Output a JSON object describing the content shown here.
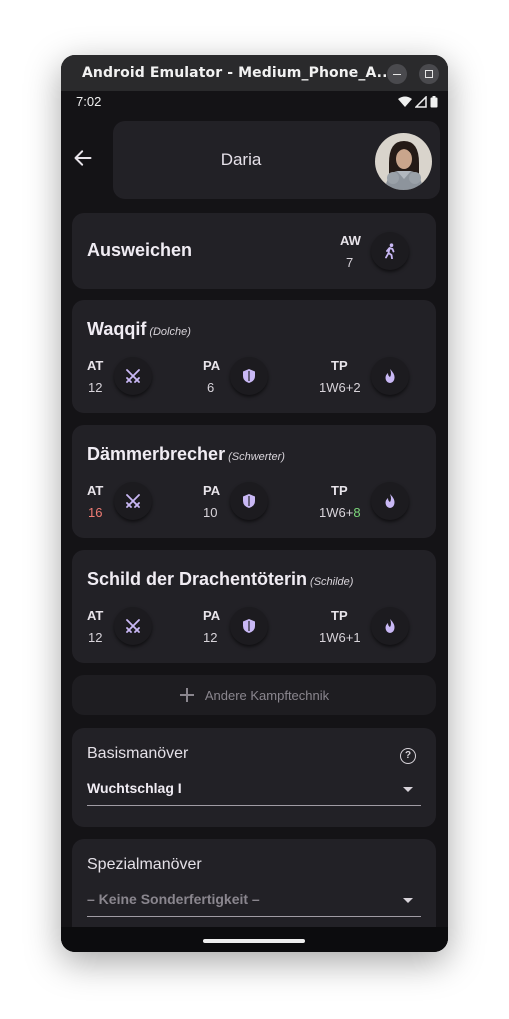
{
  "window": {
    "title": "Android Emulator - Medium_Phone_A..."
  },
  "status": {
    "time": "7:02"
  },
  "header": {
    "character_name": "Daria"
  },
  "dodge": {
    "title": "Ausweichen",
    "stat_label": "AW",
    "stat_value": "7"
  },
  "weapons": [
    {
      "name": "Waqqif",
      "type": "(Dolche)",
      "at_label": "AT",
      "at": "12",
      "pa_label": "PA",
      "pa": "6",
      "tp_label": "TP",
      "tp_base": "1W6+",
      "tp_bonus": "2"
    },
    {
      "name": "Dämmerbrecher",
      "type": "(Schwerter)",
      "at_label": "AT",
      "at": "16",
      "pa_label": "PA",
      "pa": "10",
      "tp_label": "TP",
      "tp_base": "1W6+",
      "tp_bonus": "8"
    },
    {
      "name": "Schild der Drachentöterin",
      "type": "(Schilde)",
      "at_label": "AT",
      "at": "12",
      "pa_label": "PA",
      "pa": "12",
      "tp_label": "TP",
      "tp_base": "1W6+",
      "tp_bonus": "1"
    }
  ],
  "add_technique": {
    "label": "Andere Kampftechnik"
  },
  "basic_maneuver": {
    "title": "Basismanöver",
    "selected": "Wuchtschlag I"
  },
  "special_maneuver": {
    "title": "Spezialmanöver",
    "selected": "– Keine Sonderfertigkeit –"
  },
  "colors": {
    "background": "#141316",
    "card": "#222126",
    "icon_accent": "#c9b8f5",
    "attack_highlight": "#f07c74",
    "damage_bonus_highlight": "#7bd67a"
  }
}
